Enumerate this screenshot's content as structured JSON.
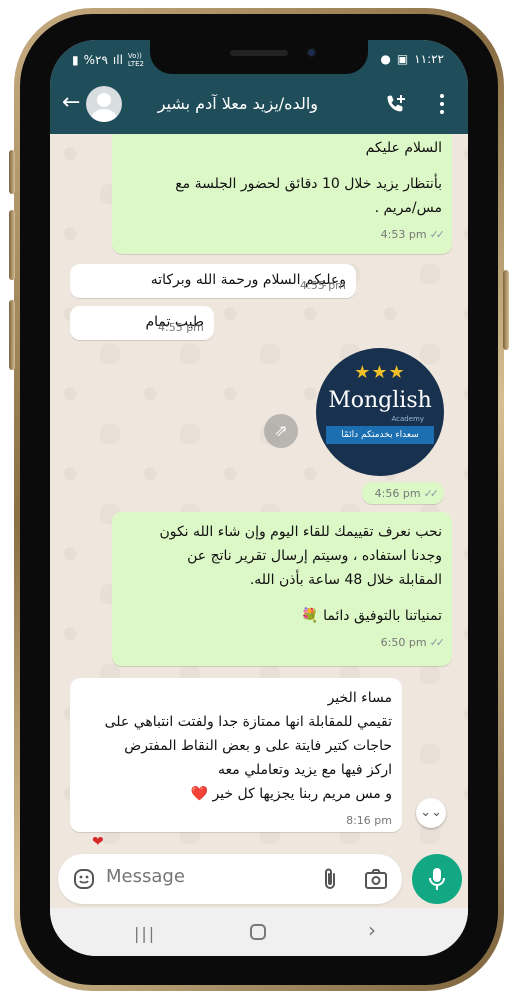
{
  "status_bar": {
    "battery": "%٢٩",
    "carrier": "Vo)) LTE2",
    "time": "١١:٢٢"
  },
  "header": {
    "contact_name": "والده/يزيد معلا آدم بشير"
  },
  "messages": [
    {
      "type": "outgoing",
      "lines": [
        "السلام عليكم",
        "",
        "بأنتظار يزيد خلال 10 دقائق لحضور الجلسة مع",
        "مس/مريم ."
      ],
      "time": "4:53 pm"
    },
    {
      "type": "incoming",
      "text": "وعليكم السلام ورحمة الله وبركاته",
      "time": "4:55 pm"
    },
    {
      "type": "incoming",
      "text": "طيب تمام",
      "time": "4:55 pm"
    },
    {
      "type": "outgoing-image",
      "image": {
        "brand": "Monglish",
        "sub": "Academy",
        "ribbon": "سعداء بخدمتكم دائمًا"
      },
      "time": "4:56 pm"
    },
    {
      "type": "outgoing",
      "lines": [
        "نحب نعرف تقييمك للقاء اليوم وإن شاء الله نكون",
        "وجدنا استفاده ، وسيتم إرسال تقرير ناتج عن",
        "المقابلة خلال 48 ساعة بأذن الله.",
        "",
        "تمنياتنا بالتوفيق دائما 💐"
      ],
      "time": "6:50 pm"
    },
    {
      "type": "incoming",
      "lines": [
        "مساء الخير",
        "تقيمي للمقابلة انها ممتازة جدا ولفتت انتباهي على",
        "حاجات كتير فايتة على و بعض النقاط  المفترض",
        "اركز فيها مع يزيد وتعاملي معه",
        "و مس مريم ربنا يجزيها كل خير ❤️"
      ],
      "time": "8:16 pm"
    }
  ],
  "composer": {
    "placeholder": "Message"
  },
  "colors": {
    "header": "#1f4d5a",
    "outgoing": "#dcf8c6",
    "incoming": "#ffffff",
    "mic": "#12a884"
  }
}
